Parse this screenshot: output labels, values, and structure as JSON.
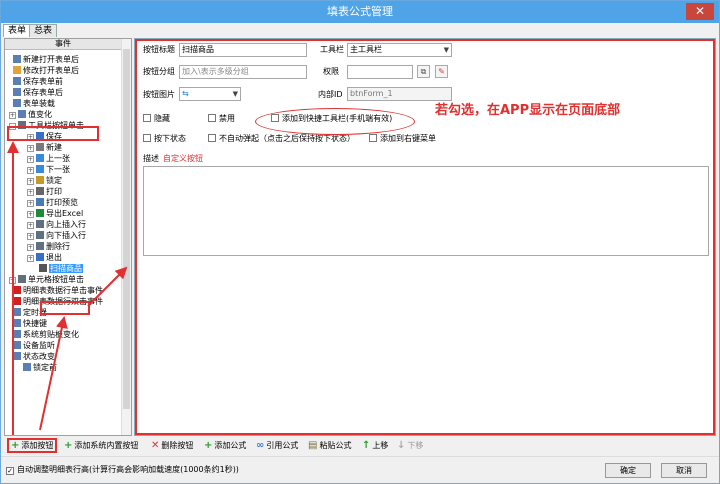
{
  "window": {
    "title": "填表公式管理",
    "close_glyph": "✕"
  },
  "tabs": [
    {
      "label": "表单"
    },
    {
      "label": "总表"
    }
  ],
  "left": {
    "header": "事件",
    "items": [
      {
        "label": "新建打开表单后",
        "icon": "doc-icon"
      },
      {
        "label": "修改打开表单后",
        "icon": "folder-icon"
      },
      {
        "label": "保存表单前",
        "icon": "doc-icon"
      },
      {
        "label": "保存表单后",
        "icon": "doc-icon"
      },
      {
        "label": "表单装载",
        "icon": "doc-icon"
      },
      {
        "label": "值变化",
        "icon": "doc-icon"
      },
      {
        "label": "工具栏按钮单击",
        "icon": "grid-icon"
      },
      {
        "label": "保存",
        "icon": "save-icon"
      },
      {
        "label": "新建",
        "icon": "new-icon"
      },
      {
        "label": "上一张",
        "icon": "up-icon"
      },
      {
        "label": "下一张",
        "icon": "down-icon"
      },
      {
        "label": "锁定",
        "icon": "lock-icon"
      },
      {
        "label": "打印",
        "icon": "print-icon"
      },
      {
        "label": "打印预览",
        "icon": "preview-icon"
      },
      {
        "label": "导出Excel",
        "icon": "excel-icon"
      },
      {
        "label": "向上插入行",
        "icon": "grid-icon"
      },
      {
        "label": "向下插入行",
        "icon": "grid-icon"
      },
      {
        "label": "删除行",
        "icon": "grid-icon"
      },
      {
        "label": "退出",
        "icon": "exit-icon"
      },
      {
        "label": "扫描商品",
        "icon": "scan-icon"
      },
      {
        "label": "单元格按钮单击",
        "icon": "grid-icon"
      },
      {
        "label": "明细表数据行单击事件",
        "icon": "flag-icon"
      },
      {
        "label": "明细表数据行双击事件",
        "icon": "flag-icon"
      },
      {
        "label": "定时器",
        "icon": "doc-icon"
      },
      {
        "label": "快捷键",
        "icon": "doc-icon"
      },
      {
        "label": "系统剪贴板变化",
        "icon": "doc-icon"
      },
      {
        "label": "设备监听",
        "icon": "doc-icon"
      },
      {
        "label": "状态改变",
        "icon": "doc-icon"
      },
      {
        "label": "锁定前",
        "icon": "doc-icon"
      }
    ]
  },
  "form": {
    "btn_title_label": "按钮标题",
    "btn_title_value": "扫描商品",
    "toolbar_label": "工具栏",
    "toolbar_value": "主工具栏",
    "group_label": "按钮分组",
    "group_placeholder": "加入\\表示多级分组",
    "permission_label": "权限",
    "image_label": "按钮图片",
    "image_value": "⇆",
    "internal_id_label": "内部ID",
    "internal_id_value": "btnForm_1",
    "hide_label": "隐藏",
    "disable_label": "禁用",
    "shortcut_toolbar_label": "添加到快捷工具栏(手机端有效)",
    "press_state_label": "按下状态",
    "no_auto_popup_label": "不自动弹起（点击之后保持按下状态）",
    "right_menu_label": "添加到右键菜单",
    "desc_label": "描述",
    "desc_value": "自定义按钮",
    "annotation": "若勾选，在APP显示在页面底部"
  },
  "toolbar": {
    "add_button": "添加按钮",
    "add_system_button": "添加系统内置按钮",
    "delete_button": "删除按钮",
    "add_formula": "添加公式",
    "ref_formula": "引用公式",
    "paste_formula": "粘贴公式",
    "move_up": "上移",
    "move_down": "下移"
  },
  "bottom": {
    "auto_adjust_label": "自动调整明细表行高(计算行高会影响加载速度(1000条约1秒))",
    "ok": "确定",
    "cancel": "取消"
  },
  "colors": {
    "title_bar": "#4ea4e6",
    "annotation": "#e03030",
    "selection": "#3399ff"
  }
}
